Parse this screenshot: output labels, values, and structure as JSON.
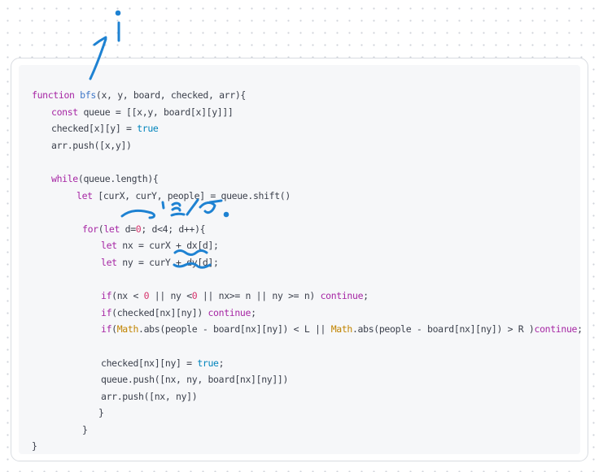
{
  "colors": {
    "keyword": "#a626a4",
    "function": "#4078c8",
    "boolean": "#0184bc",
    "number": "#d6336c",
    "builtin_class": "#c18401",
    "plain": "#3a3f4b",
    "ink": "#1e82d2"
  },
  "code": {
    "lines": [
      {
        "id": "l1",
        "indent": 0,
        "tokens": [
          {
            "t": "function ",
            "k": "kw"
          },
          {
            "t": "bfs",
            "k": "fn"
          },
          {
            "t": "(x, y, board, checked, arr){",
            "k": ""
          }
        ]
      },
      {
        "id": "l2",
        "indent": 1,
        "tokens": [
          {
            "t": "const",
            "k": "kw"
          },
          {
            "t": " queue = [[x,y, board[x][y]]]",
            "k": ""
          }
        ]
      },
      {
        "id": "l3",
        "indent": 1,
        "tokens": [
          {
            "t": "checked[x][y] = ",
            "k": ""
          },
          {
            "t": "true",
            "k": "bool"
          }
        ]
      },
      {
        "id": "l4",
        "indent": 1,
        "tokens": [
          {
            "t": "arr.push([x,y])",
            "k": ""
          }
        ]
      },
      {
        "id": "l5",
        "indent": 0,
        "tokens": []
      },
      {
        "id": "l6",
        "indent": 1,
        "tokens": [
          {
            "t": "while",
            "k": "kw"
          },
          {
            "t": "(queue.length){",
            "k": ""
          }
        ]
      },
      {
        "id": "l7",
        "indent": 2,
        "tokens": [
          {
            "t": "let",
            "k": "kw"
          },
          {
            "t": " [curX, curY, people] = queue.shift()",
            "k": ""
          }
        ]
      },
      {
        "id": "l8",
        "indent": 0,
        "tokens": []
      },
      {
        "id": "l9",
        "indent": 3,
        "tokens": [
          {
            "t": "for",
            "k": "kw"
          },
          {
            "t": "(",
            "k": ""
          },
          {
            "t": "let",
            "k": "kw"
          },
          {
            "t": " d=",
            "k": ""
          },
          {
            "t": "0",
            "k": "num"
          },
          {
            "t": "; d<4; d++){",
            "k": ""
          }
        ]
      },
      {
        "id": "l10",
        "indent": 4,
        "tokens": [
          {
            "t": "let",
            "k": "kw"
          },
          {
            "t": " nx = curX + dx[d];",
            "k": ""
          }
        ]
      },
      {
        "id": "l11",
        "indent": 4,
        "tokens": [
          {
            "t": "let",
            "k": "kw"
          },
          {
            "t": " ny = curY + dy[d];",
            "k": ""
          }
        ]
      },
      {
        "id": "l12",
        "indent": 0,
        "tokens": []
      },
      {
        "id": "l13",
        "indent": 4,
        "tokens": [
          {
            "t": "if",
            "k": "kw"
          },
          {
            "t": "(nx < ",
            "k": ""
          },
          {
            "t": "0",
            "k": "num"
          },
          {
            "t": " || ny <",
            "k": ""
          },
          {
            "t": "0",
            "k": "num"
          },
          {
            "t": " || nx>= n || ny >= n) ",
            "k": ""
          },
          {
            "t": "continue",
            "k": "kw"
          },
          {
            "t": ";",
            "k": ""
          }
        ]
      },
      {
        "id": "l14",
        "indent": 4,
        "tokens": [
          {
            "t": "if",
            "k": "kw"
          },
          {
            "t": "(checked[nx][ny]) ",
            "k": ""
          },
          {
            "t": "continue",
            "k": "kw"
          },
          {
            "t": ";",
            "k": ""
          }
        ]
      },
      {
        "id": "l15",
        "indent": 4,
        "tokens": [
          {
            "t": "if",
            "k": "kw"
          },
          {
            "t": "(",
            "k": ""
          },
          {
            "t": "Math",
            "k": "cls"
          },
          {
            "t": ".abs(people - board[nx][ny]) < L || ",
            "k": ""
          },
          {
            "t": "Math",
            "k": "cls"
          },
          {
            "t": ".abs(people - board[nx][ny]) > R )",
            "k": ""
          },
          {
            "t": "continue",
            "k": "kw"
          },
          {
            "t": ";",
            "k": ""
          }
        ]
      },
      {
        "id": "l16",
        "indent": 0,
        "tokens": []
      },
      {
        "id": "l17",
        "indent": 4,
        "tokens": [
          {
            "t": "checked[nx][ny] = ",
            "k": ""
          },
          {
            "t": "true",
            "k": "bool"
          },
          {
            "t": ";",
            "k": ""
          }
        ]
      },
      {
        "id": "l18",
        "indent": 4,
        "tokens": [
          {
            "t": "queue.push([nx, ny, board[nx][ny]])",
            "k": ""
          }
        ]
      },
      {
        "id": "l19",
        "indent": 4,
        "tokens": [
          {
            "t": "arr.push([nx, ny])",
            "k": ""
          }
        ]
      },
      {
        "id": "l20",
        "indent": 5,
        "tokens": [
          {
            "t": "}",
            "k": ""
          }
        ]
      },
      {
        "id": "l21",
        "indent": 3,
        "tokens": [
          {
            "t": "}",
            "k": ""
          }
        ]
      },
      {
        "id": "l22",
        "indent": 0,
        "tokens": [
          {
            "t": "}",
            "k": ""
          }
        ]
      }
    ]
  }
}
